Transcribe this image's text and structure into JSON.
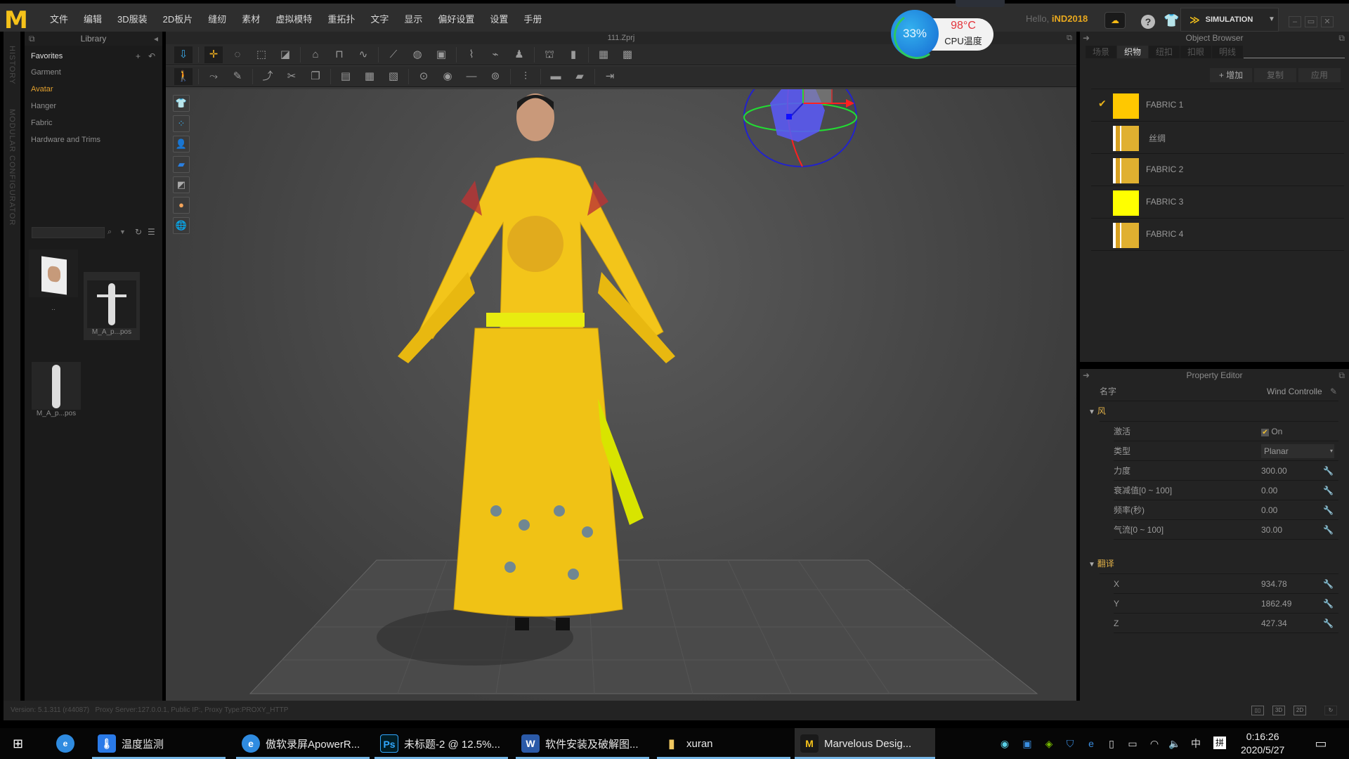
{
  "app": {
    "logo_icon": "marvelous-designer-logo",
    "menu": [
      "文件",
      "编辑",
      "3D服装",
      "2D板片",
      "缝纫",
      "素材",
      "虚拟模特",
      "重拓扑",
      "文字",
      "显示",
      "偏好设置",
      "设置",
      "手册"
    ],
    "hello_prefix": "Hello, ",
    "username": "iND2018",
    "mode_label": "SIMULATION",
    "window_controls": [
      "–",
      "▭",
      "✕"
    ]
  },
  "cpu_widget": {
    "usage": "33%",
    "temperature": "98°C",
    "label": "CPU温度"
  },
  "side_tabs": [
    "HISTORY",
    "MODULAR CONFIGURATOR"
  ],
  "library": {
    "title": "Library",
    "items": [
      {
        "label": "Favorites",
        "state": "header"
      },
      {
        "label": "Garment",
        "state": "normal"
      },
      {
        "label": "Avatar",
        "state": "selected"
      },
      {
        "label": "Hanger",
        "state": "normal"
      },
      {
        "label": "Fabric",
        "state": "normal"
      },
      {
        "label": "Hardware and Trims",
        "state": "normal"
      }
    ],
    "search_value": "",
    "thumbnails": [
      {
        "label": "..",
        "kind": "folder"
      },
      {
        "label": "M_A_p...pos",
        "kind": "avatar-apose"
      },
      {
        "label": "M_A_p...pos",
        "kind": "avatar-standing"
      }
    ]
  },
  "viewport": {
    "file_title": "111.Zprj",
    "colors": {
      "gizmo_x": "#ff2020",
      "gizmo_y": "#22dd33",
      "gizmo_z": "#2222cc"
    }
  },
  "object_browser": {
    "title": "Object Browser",
    "tabs": [
      {
        "label": "场景",
        "active": false
      },
      {
        "label": "织物",
        "active": true
      },
      {
        "label": "纽扣",
        "active": false
      },
      {
        "label": "扣眼",
        "active": false
      },
      {
        "label": "明线",
        "active": false
      }
    ],
    "buttons": {
      "add": "+ 增加",
      "copy": "复制",
      "apply": "应用"
    },
    "fabrics": [
      {
        "name": "FABRIC 1",
        "checked": true,
        "swatch": "#ffc800"
      },
      {
        "name": "丝绸",
        "checked": false,
        "swatch": "pattern"
      },
      {
        "name": "FABRIC 2",
        "checked": false,
        "swatch": "pattern"
      },
      {
        "name": "FABRIC 3",
        "checked": false,
        "swatch": "#ffff00"
      },
      {
        "name": "FABRIC 4",
        "checked": false,
        "swatch": "pattern"
      }
    ]
  },
  "property_editor": {
    "title": "Property Editor",
    "name_label": "名字",
    "name_value": "Wind Controlle",
    "wind_section": "风",
    "wind_rows": [
      {
        "label": "激活",
        "value": "On",
        "type": "checkbox",
        "checked": true
      },
      {
        "label": "类型",
        "value": "Planar",
        "type": "select"
      },
      {
        "label": "力度",
        "value": "300.00",
        "type": "number"
      },
      {
        "label": "衰减值[0 ~ 100]",
        "value": "0.00",
        "type": "number"
      },
      {
        "label": "频率(秒)",
        "value": "0.00",
        "type": "number"
      },
      {
        "label": "气流[0 ~ 100]",
        "value": "30.00",
        "type": "number"
      }
    ],
    "translate_section": "翻译",
    "translate_rows": [
      {
        "label": "X",
        "value": "934.78"
      },
      {
        "label": "Y",
        "value": "1862.49"
      },
      {
        "label": "Z",
        "value": "427.34"
      }
    ]
  },
  "statusbar": {
    "version": "Version: 5.1.311 (r44087)",
    "proxy": "Proxy Server:127.0.0.1, Public IP:, Proxy Type:PROXY_HTTP",
    "view_buttons": [
      "split-view",
      "3D",
      "2D",
      "refresh"
    ]
  },
  "taskbar": {
    "tasks": [
      {
        "label": "温度监测",
        "icon": "thermometer-icon"
      },
      {
        "label": "傲软录屏ApowerR...",
        "icon": "browser-icon"
      },
      {
        "label": "未标题-2 @ 12.5%...",
        "icon": "photoshop-icon"
      },
      {
        "label": "软件安装及破解图...",
        "icon": "word-icon"
      },
      {
        "label": "xuran",
        "icon": "folder-icon"
      },
      {
        "label": "Marvelous Desig...",
        "icon": "marvelous-icon",
        "active": true
      }
    ],
    "ime_lang": "中",
    "ime_mode": "拼",
    "time": "0:16:26",
    "date": "2020/5/27"
  }
}
